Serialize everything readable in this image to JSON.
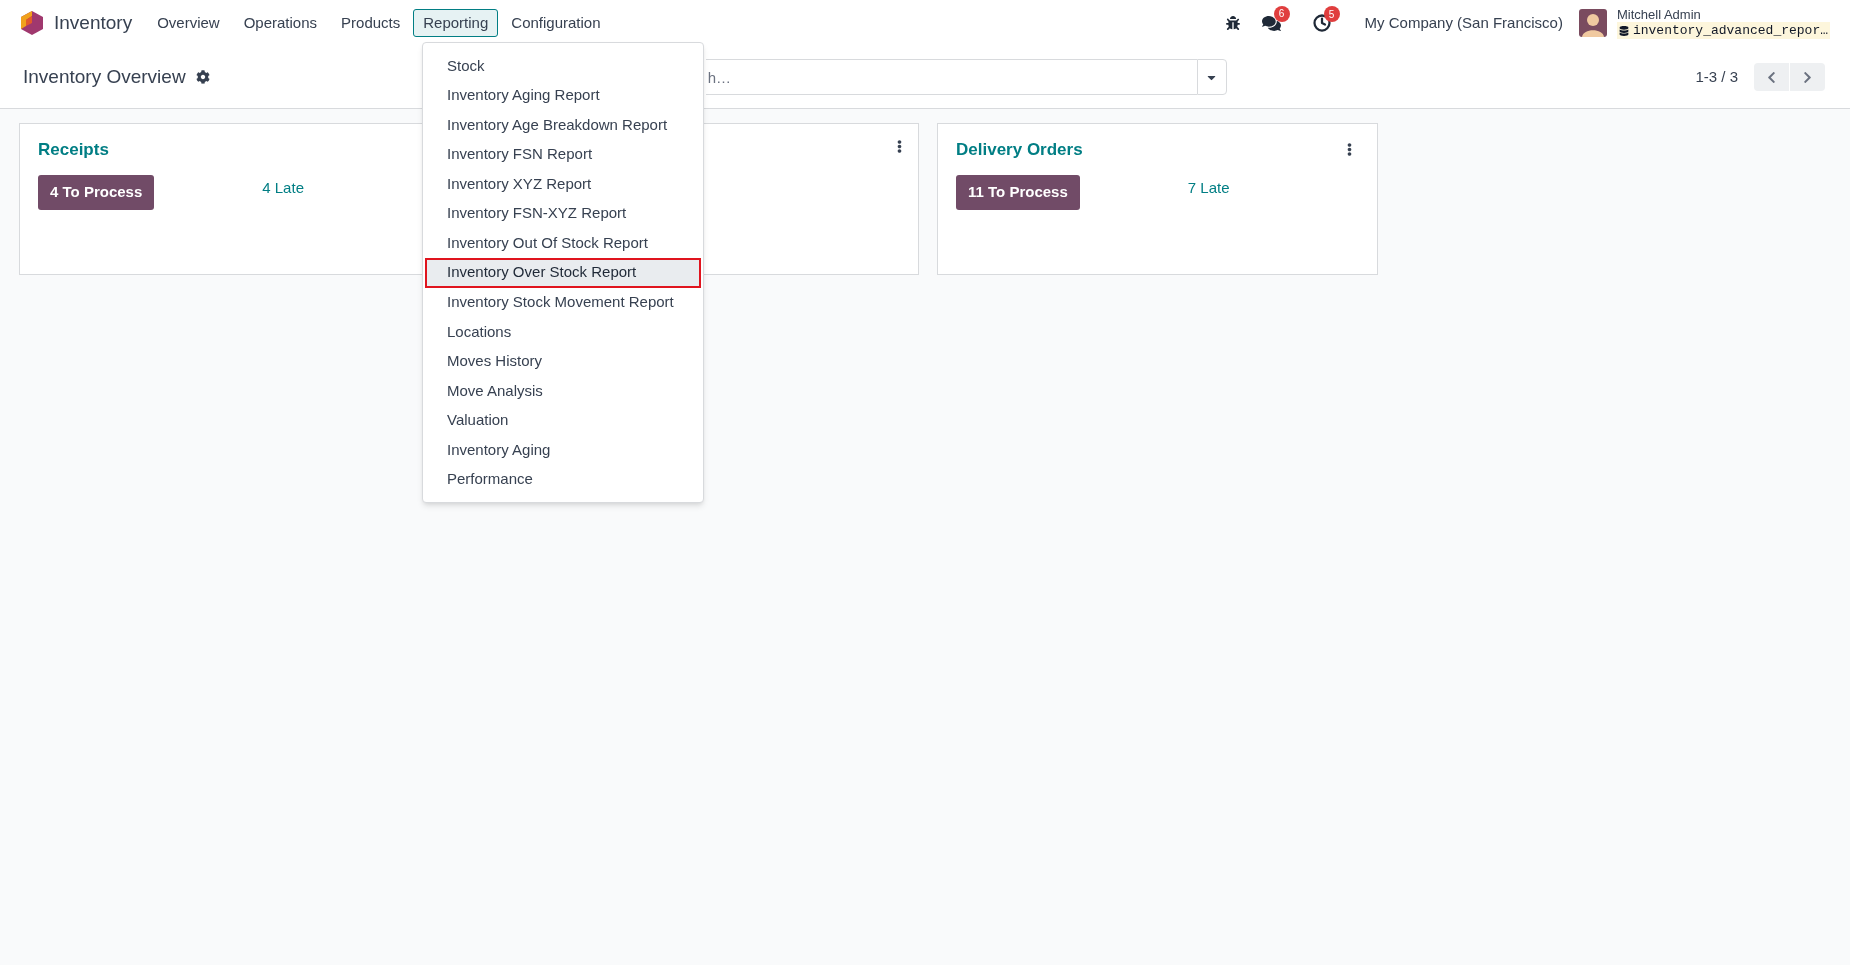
{
  "navbar": {
    "app_name": "Inventory",
    "menus": [
      {
        "label": "Overview",
        "selected": false
      },
      {
        "label": "Operations",
        "selected": false
      },
      {
        "label": "Products",
        "selected": false
      },
      {
        "label": "Reporting",
        "selected": true
      },
      {
        "label": "Configuration",
        "selected": false
      }
    ],
    "messages_badge": "6",
    "activities_badge": "5",
    "company": "My Company (San Francisco)",
    "user_name": "Mitchell Admin",
    "database": "inventory_advanced_repor…"
  },
  "dropdown": {
    "items": [
      {
        "label": "Stock",
        "selected": false
      },
      {
        "label": "Inventory Aging Report",
        "selected": false
      },
      {
        "label": "Inventory Age Breakdown Report",
        "selected": false
      },
      {
        "label": "Inventory FSN Report",
        "selected": false
      },
      {
        "label": "Inventory XYZ Report",
        "selected": false
      },
      {
        "label": "Inventory FSN-XYZ Report",
        "selected": false
      },
      {
        "label": "Inventory Out Of Stock Report",
        "selected": false
      },
      {
        "label": "Inventory Over Stock Report",
        "selected": true
      },
      {
        "label": "Inventory Stock Movement Report",
        "selected": false
      },
      {
        "label": "Locations",
        "selected": false
      },
      {
        "label": "Moves History",
        "selected": false
      },
      {
        "label": "Move Analysis",
        "selected": false
      },
      {
        "label": "Valuation",
        "selected": false
      },
      {
        "label": "Inventory Aging",
        "selected": false
      },
      {
        "label": "Performance",
        "selected": false
      }
    ]
  },
  "control_panel": {
    "title": "Inventory Overview",
    "search": {
      "placeholder": "h…"
    },
    "pager": "1-3 / 3"
  },
  "cards": [
    {
      "kind": "operation",
      "title": "Receipts",
      "to_process": "4 To Process",
      "late": "4 Late"
    },
    {
      "kind": "covered"
    },
    {
      "kind": "operation",
      "title": "Delivery Orders",
      "to_process": "11 To Process",
      "late": "7 Late"
    }
  ]
}
